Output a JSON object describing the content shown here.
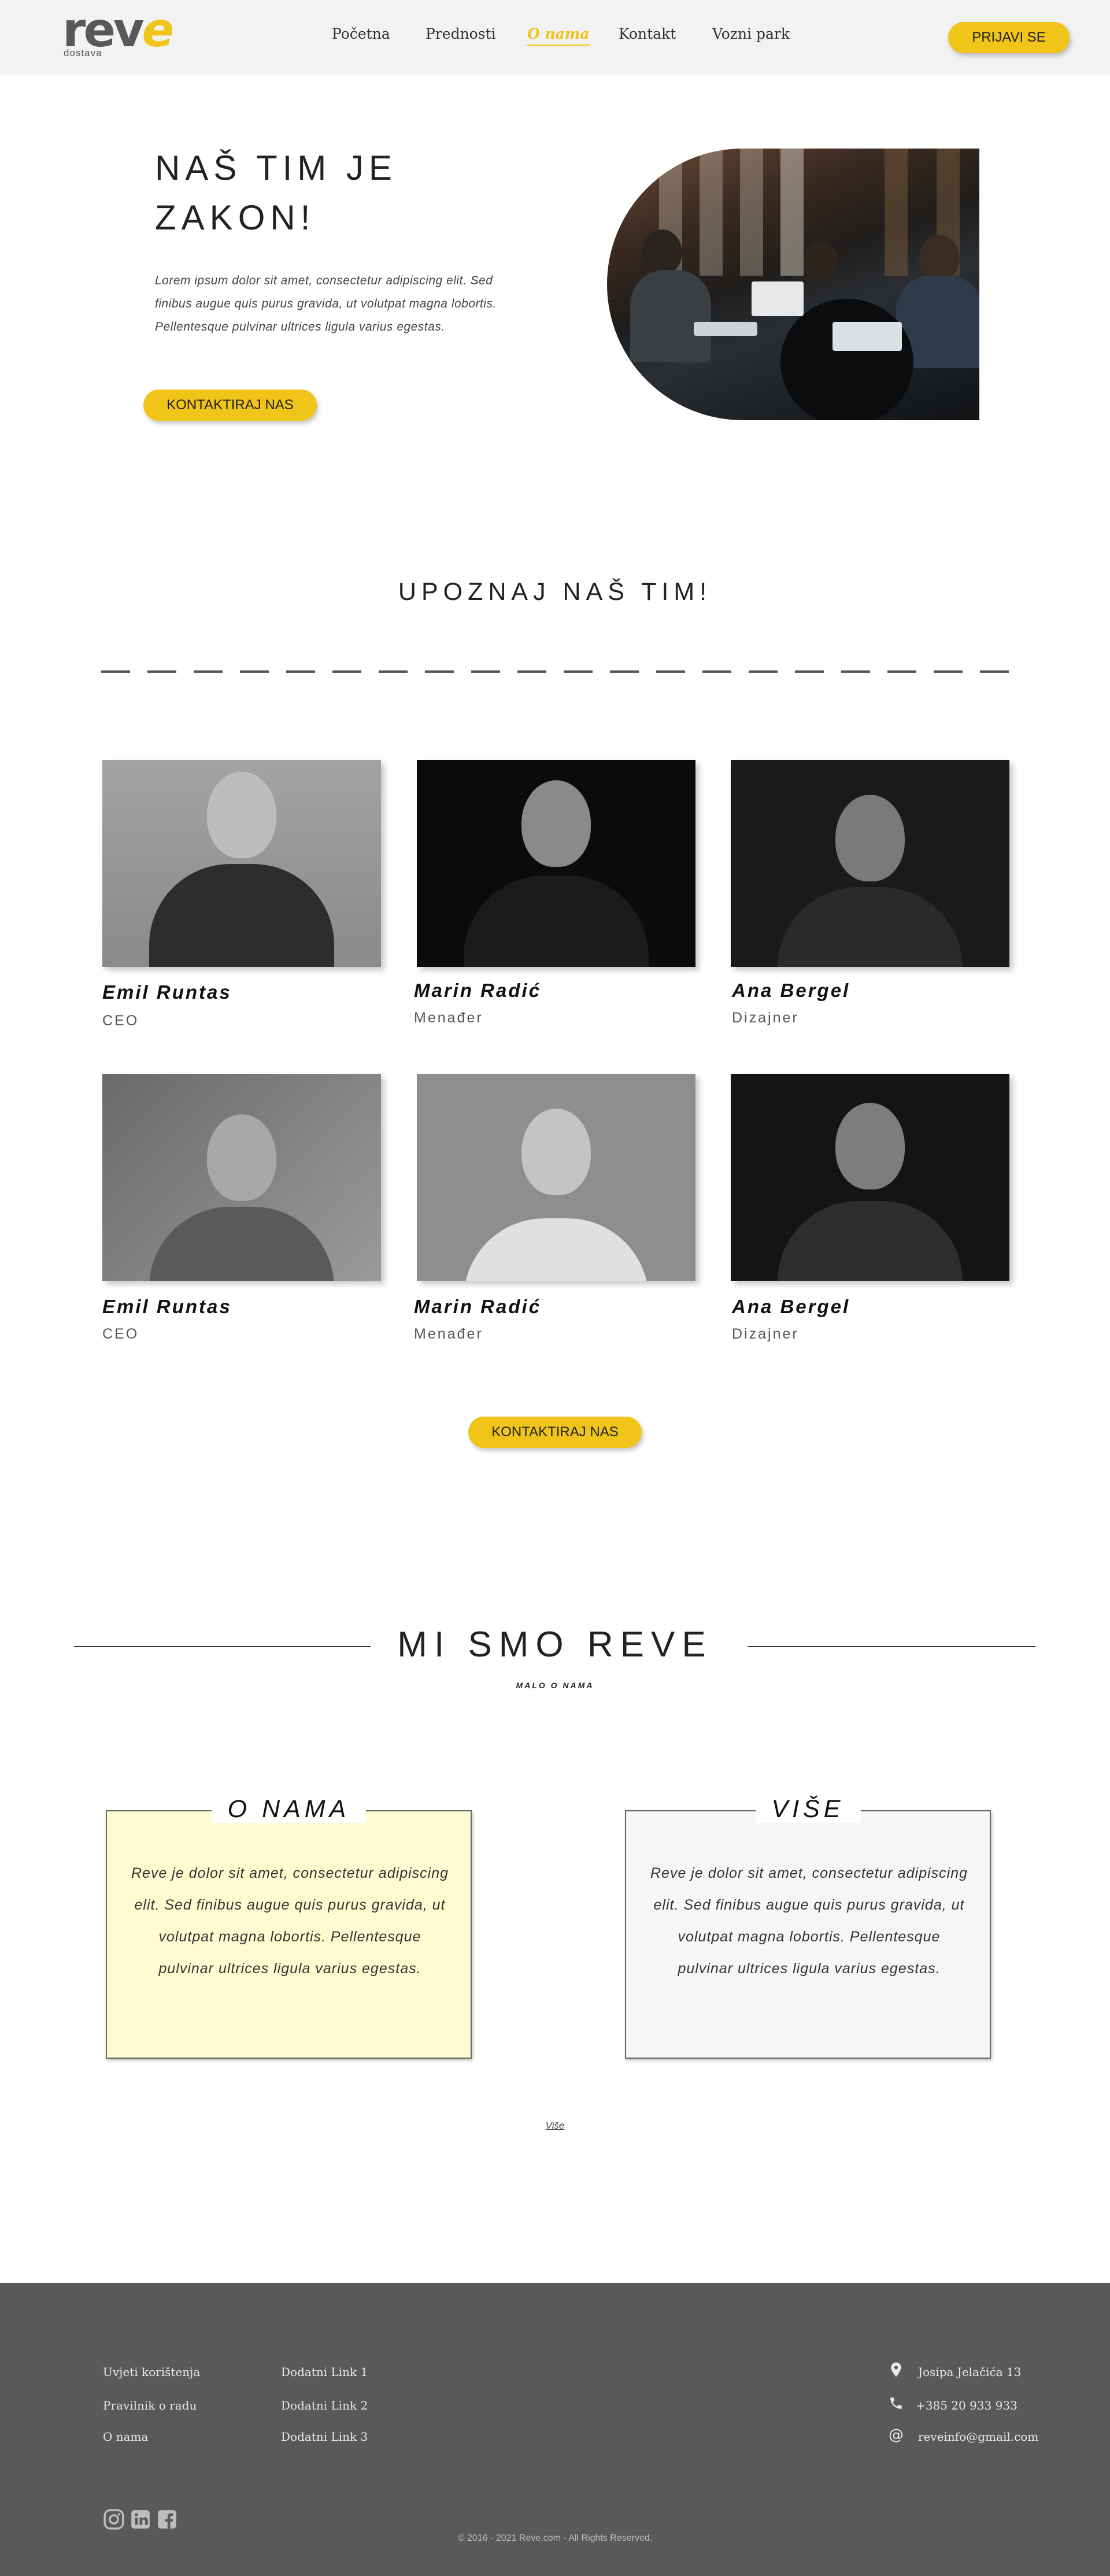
{
  "header": {
    "logo_word_gray": "rev",
    "logo_word_yellow": "e",
    "logo_sub": "dostava",
    "nav": [
      "Početna",
      "Prednosti",
      "O nama",
      "Kontakt",
      "Vozni park"
    ],
    "active_nav": "O nama",
    "login_label": "PRIJAVI SE"
  },
  "hero": {
    "title": "NAŠ TIM JE ZAKON!",
    "text": "Lorem ipsum dolor sit amet, consectetur adipiscing elit. Sed finibus augue quis purus gravida, ut volutpat magna lobortis. Pellentesque pulvinar ultrices ligula varius egestas.",
    "button_label": "KONTAKTIRAJ NAS"
  },
  "team": {
    "title": "UPOZNAJ NAŠ TIM!",
    "members": [
      {
        "name": "Emil Runtas",
        "role": "CEO"
      },
      {
        "name": "Marin Radić",
        "role": "Menađer"
      },
      {
        "name": "Ana Bergel",
        "role": "Dizajner"
      },
      {
        "name": "Emil Runtas",
        "role": "CEO"
      },
      {
        "name": "Marin Radić",
        "role": "Menađer"
      },
      {
        "name": "Ana Bergel",
        "role": "Dizajner"
      }
    ],
    "button_label": "KONTAKTIRAJ NAS"
  },
  "about": {
    "title": "MI SMO REVE",
    "subtitle": "MALO O NAMA",
    "boxes": [
      {
        "title": "O NAMA",
        "text": "Reve je dolor sit amet, consectetur adipiscing elit. Sed finibus augue quis purus gravida, ut volutpat magna lobortis. Pellentesque pulvinar ultrices ligula varius egestas.",
        "bg": "#fffbd1"
      },
      {
        "title": "VIŠE",
        "text": "Reve je dolor sit amet, consectetur adipiscing elit. Sed finibus augue quis purus gravida, ut volutpat magna lobortis. Pellentesque pulvinar ultrices ligula varius egestas.",
        "bg": "#f6f6f6"
      }
    ],
    "more_link": "Više"
  },
  "footer": {
    "links_col1": [
      "Uvjeti korištenja",
      "Pravilnik o radu",
      "O nama"
    ],
    "links_col2": [
      "Dodatni Link 1",
      "Dodatni Link 2",
      "Dodatni Link 3"
    ],
    "address": "Josipa Jelačića 13",
    "phone": "+385 20 933 933",
    "email": "reveinfo@gmail.com",
    "copyright": "© 2016 - 2021 Reve.com - All Rights Reserved.",
    "social_icons": [
      "instagram-icon",
      "linkedin-icon",
      "facebook-icon"
    ]
  },
  "colors": {
    "accent": "#f0c419",
    "footer_bg": "#58595b",
    "logo_gray": "#585858"
  }
}
